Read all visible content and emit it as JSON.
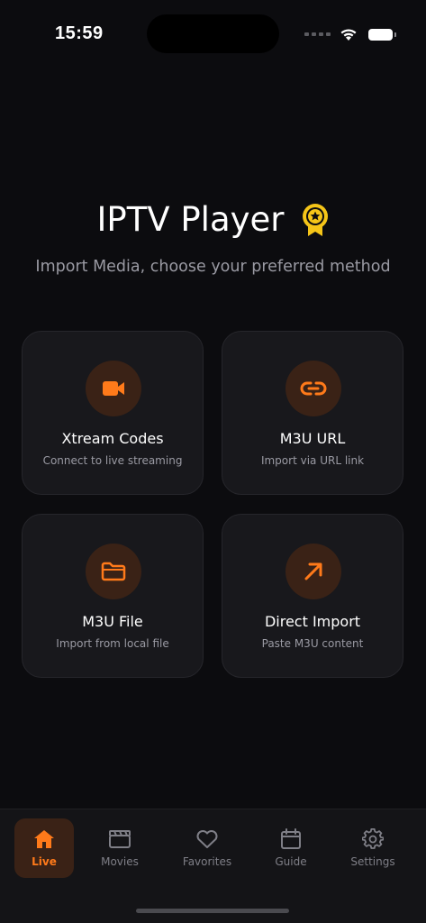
{
  "status_bar": {
    "time": "15:59"
  },
  "header": {
    "title": "IPTV Player",
    "badge_icon": "award-ribbon-icon",
    "subtitle": "Import Media, choose your preferred method"
  },
  "colors": {
    "accent": "#ff7a1a",
    "badge": "#f5c518",
    "card_bg": "#18181c",
    "background": "#0c0c0f"
  },
  "import_options": [
    {
      "title": "Xtream Codes",
      "subtitle": "Connect to live streaming",
      "icon": "video-camera-icon"
    },
    {
      "title": "M3U URL",
      "subtitle": "Import via URL link",
      "icon": "link-icon"
    },
    {
      "title": "M3U File",
      "subtitle": "Import from local file",
      "icon": "folder-icon"
    },
    {
      "title": "Direct Import",
      "subtitle": "Paste M3U content",
      "icon": "arrow-up-right-icon"
    }
  ],
  "tabbar": {
    "active": "Live",
    "tabs": [
      {
        "label": "Live",
        "icon": "home-icon"
      },
      {
        "label": "Movies",
        "icon": "clapperboard-icon"
      },
      {
        "label": "Favorites",
        "icon": "heart-icon"
      },
      {
        "label": "Guide",
        "icon": "calendar-icon"
      },
      {
        "label": "Settings",
        "icon": "gear-icon"
      }
    ]
  }
}
